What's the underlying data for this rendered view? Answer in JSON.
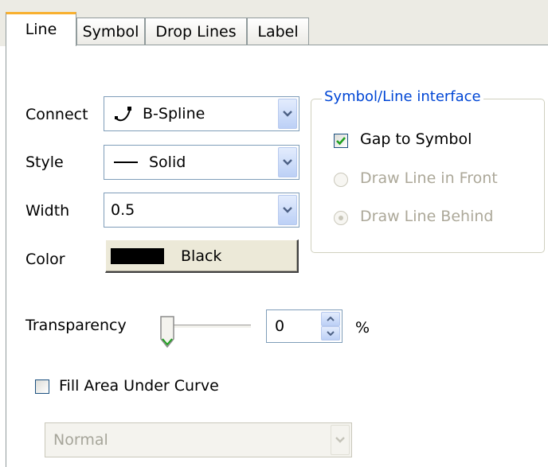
{
  "tabs": [
    "Line",
    "Symbol",
    "Drop Lines",
    "Label"
  ],
  "active_tab": "Line",
  "connect": {
    "label": "Connect",
    "value": "B-Spline"
  },
  "style": {
    "label": "Style",
    "value": "Solid"
  },
  "width": {
    "label": "Width",
    "value": "0.5"
  },
  "color": {
    "label": "Color",
    "value": "Black",
    "swatch": "#000000"
  },
  "group": {
    "title": "Symbol/Line interface",
    "gap_to_symbol": {
      "label": "Gap to Symbol",
      "checked": true
    },
    "draw_front": {
      "label": "Draw Line in Front",
      "selected": false,
      "enabled": false
    },
    "draw_behind": {
      "label": "Draw Line Behind",
      "selected": true,
      "enabled": false
    }
  },
  "transparency": {
    "label": "Transparency",
    "value": "0",
    "unit": "%"
  },
  "fill_area": {
    "label": "Fill Area Under Curve",
    "checked": false
  },
  "fill_mode": {
    "value": "Normal",
    "enabled": false
  },
  "colors": {
    "group_title": "#0046d5",
    "checkmark": "#21a121",
    "active_tab_accent": "#f8b030"
  }
}
